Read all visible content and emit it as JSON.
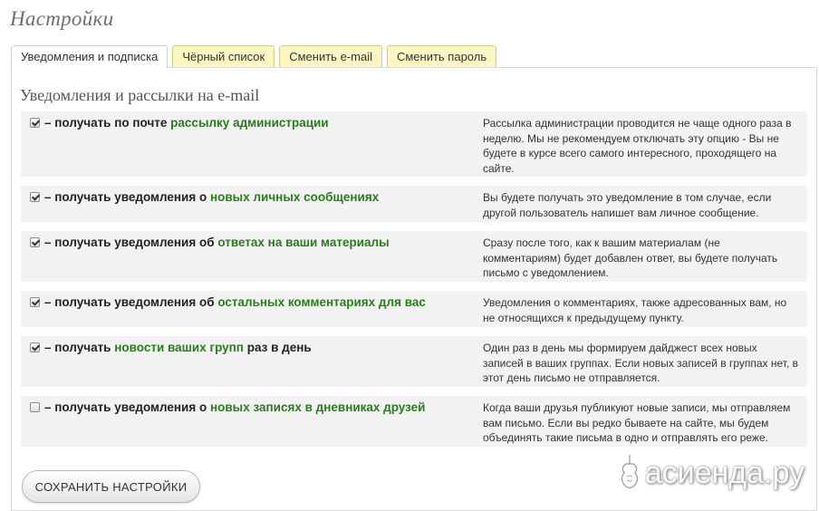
{
  "page": {
    "title": "Настройки"
  },
  "tabs": [
    {
      "label": "Уведомления и подписка",
      "active": true
    },
    {
      "label": "Чёрный список",
      "active": false
    },
    {
      "label": "Сменить e-mail",
      "active": false
    },
    {
      "label": "Сменить пароль",
      "active": false
    }
  ],
  "section": {
    "title": "Уведомления и рассылки на e-mail"
  },
  "options": [
    {
      "checked": true,
      "prefix": "– получать по почте ",
      "highlight": "рассылку администрации",
      "suffix": "",
      "description": "Рассылка администрации проводится не чаще одного раза в неделю. Мы не рекомендуем отключать эту опцию - Вы не будете в курсе всего самого интересного, проходящего на сайте."
    },
    {
      "checked": true,
      "prefix": "– получать уведомления о ",
      "highlight": "новых личных сообщениях",
      "suffix": "",
      "description": "Вы будете получать это уведомление в том случае, если другой пользователь напишет вам личное сообщение."
    },
    {
      "checked": true,
      "prefix": "– получать уведомления об ",
      "highlight": "ответах на ваши материалы",
      "suffix": "",
      "description": "Сразу после того, как к вашим материалам (не комментариям) будет добавлен ответ, вы будете получать письмо с уведомлением."
    },
    {
      "checked": true,
      "prefix": "– получать уведомления об ",
      "highlight": "остальных комментариях для вас",
      "suffix": "",
      "description": "Уведомления о комментариях, также адресованных вам, но не относящихся к предыдущему пункту."
    },
    {
      "checked": true,
      "prefix": "– получать ",
      "highlight": "новости ваших групп",
      "suffix": " раз в день",
      "description": "Один раз в день мы формируем дайджест всех новых записей в ваших группах. Если новых записей в группах нет, в этот день письмо не отправляется."
    },
    {
      "checked": false,
      "prefix": "– получать уведомления о ",
      "highlight": "новых записях в дневниках друзей",
      "suffix": "",
      "description": "Когда ваши друзья публикуют новые записи, мы отправляем вам письмо. Если вы редко бываете на сайте, мы будем объединять такие письма в одно и отправлять его реже."
    }
  ],
  "save_button": {
    "label": "СОХРАНИТЬ НАСТРОЙКИ"
  },
  "watermark": {
    "text": "асиенда.ру",
    "icon": "violin-icon"
  },
  "colors": {
    "highlight": "#2c7a1f",
    "tab_inactive": "#fdf6c3",
    "row_bg": "#f2f2f2"
  }
}
